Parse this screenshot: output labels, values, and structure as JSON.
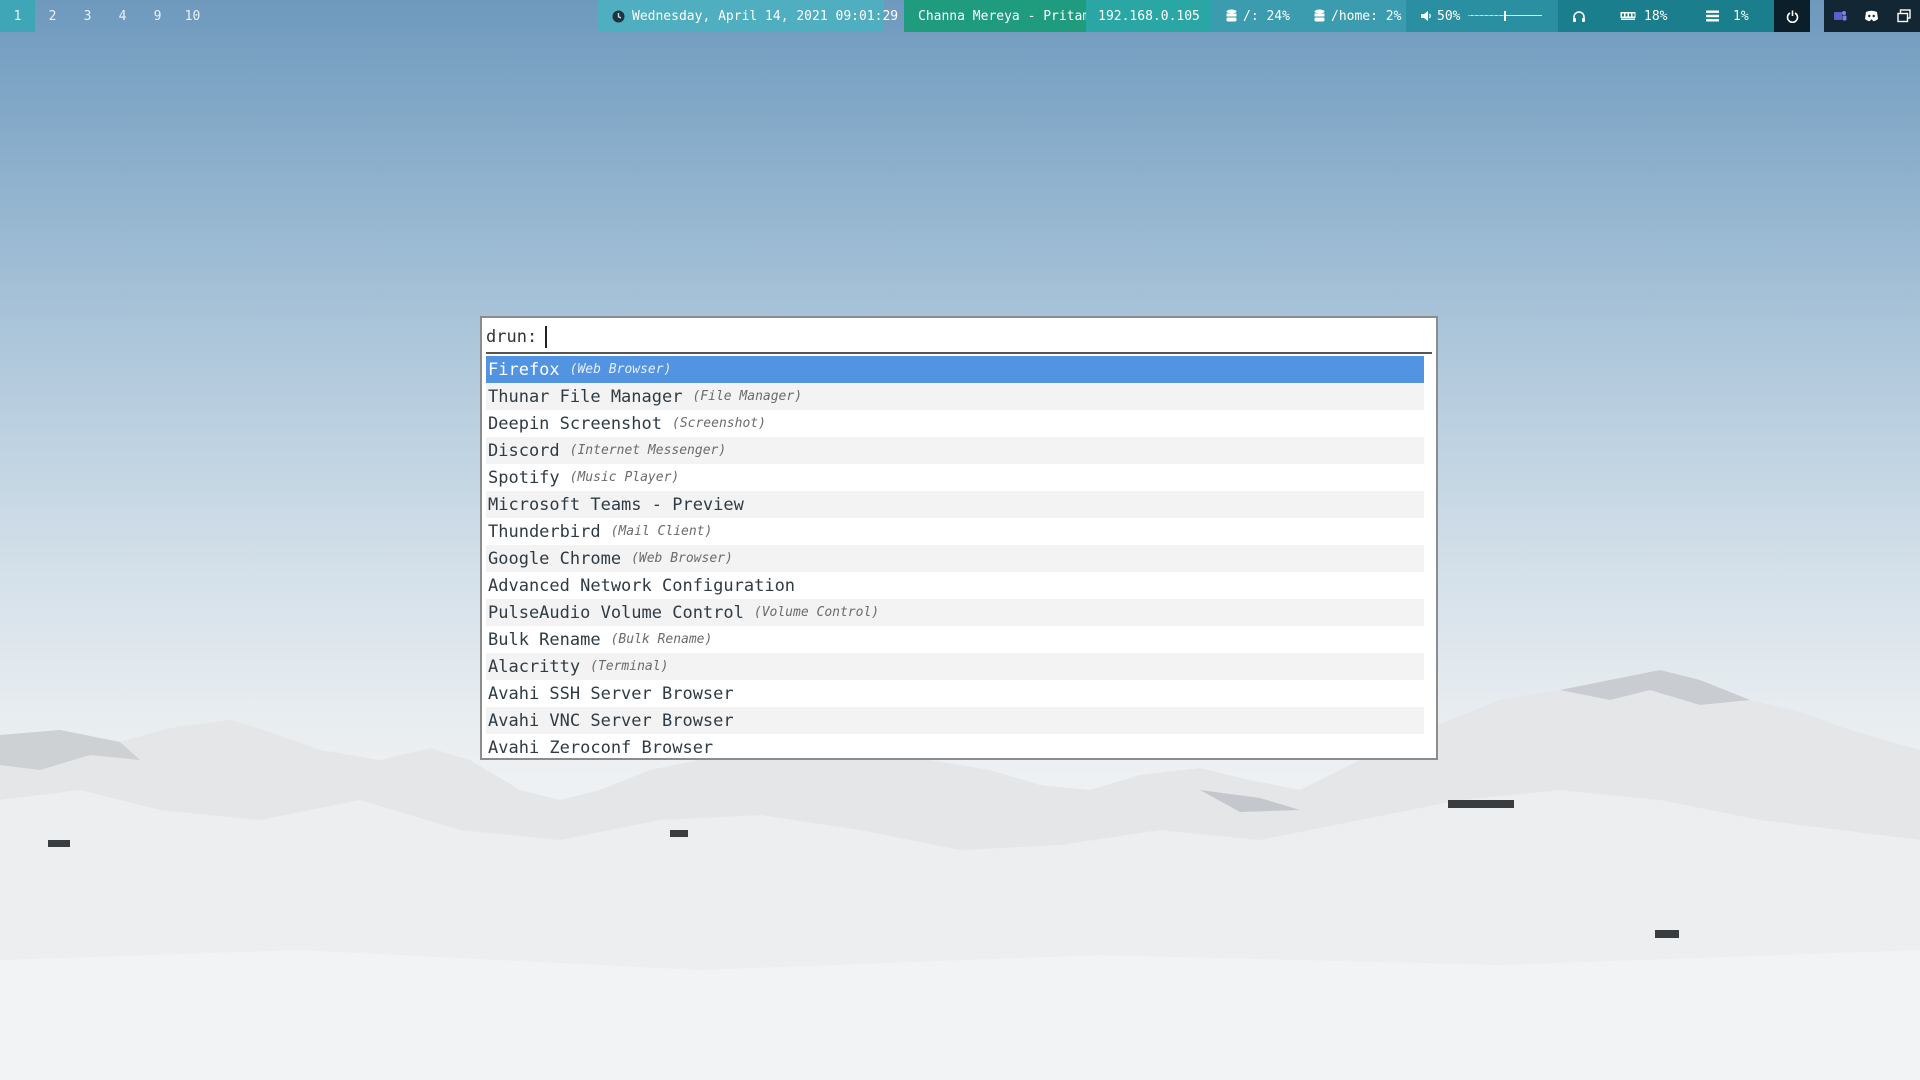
{
  "workspaces": [
    "1",
    "2",
    "3",
    "4",
    "9",
    "10"
  ],
  "active_workspace": "1",
  "bar": {
    "datetime": "Wednesday, April 14, 2021 09:01:29",
    "now_playing": "Channa Mereya - Pritam",
    "ip": "192.168.0.105",
    "disk_root": "/: 24%",
    "disk_home": "/home: 2%",
    "volume": "50%",
    "volume_level": 0.5,
    "memory": "18%",
    "cpu": "1%"
  },
  "icons": {
    "clock": "clock-icon",
    "disk": "disk-icon",
    "volume": "speaker-icon",
    "headphones": "headphones-icon",
    "memory": "ram-icon",
    "cpu": "cpu-icon",
    "power": "power-icon",
    "tray": [
      "teams-icon",
      "discord-icon",
      "window-icon"
    ]
  },
  "colors": {
    "workspace_active": "#3fa6b8",
    "datetime_bg": "#4faec0",
    "now_playing_bg": "#1f9b7e",
    "ip_bg": "#2aa6a5",
    "disk_bg": "#3a9cae",
    "volume_bg": "#2a8fa0",
    "module_dark": "#1a7e8c",
    "power_bg": "#0b1f2a",
    "tray_bg": "#122634",
    "selection": "#5294e2"
  },
  "launcher": {
    "prompt": "drun:",
    "query": "",
    "items": [
      {
        "name": "Firefox",
        "desc": "(Web Browser)"
      },
      {
        "name": "Thunar File Manager",
        "desc": "(File Manager)"
      },
      {
        "name": "Deepin Screenshot",
        "desc": "(Screenshot)"
      },
      {
        "name": "Discord",
        "desc": "(Internet Messenger)"
      },
      {
        "name": "Spotify",
        "desc": "(Music Player)"
      },
      {
        "name": "Microsoft Teams - Preview",
        "desc": ""
      },
      {
        "name": "Thunderbird",
        "desc": "(Mail Client)"
      },
      {
        "name": "Google Chrome",
        "desc": "(Web Browser)"
      },
      {
        "name": "Advanced Network Configuration",
        "desc": ""
      },
      {
        "name": "PulseAudio Volume Control",
        "desc": "(Volume Control)"
      },
      {
        "name": "Bulk Rename",
        "desc": "(Bulk Rename)"
      },
      {
        "name": "Alacritty",
        "desc": "(Terminal)"
      },
      {
        "name": "Avahi SSH Server Browser",
        "desc": ""
      },
      {
        "name": "Avahi VNC Server Browser",
        "desc": ""
      },
      {
        "name": "Avahi Zeroconf Browser",
        "desc": ""
      }
    ],
    "selected_index": 0
  }
}
